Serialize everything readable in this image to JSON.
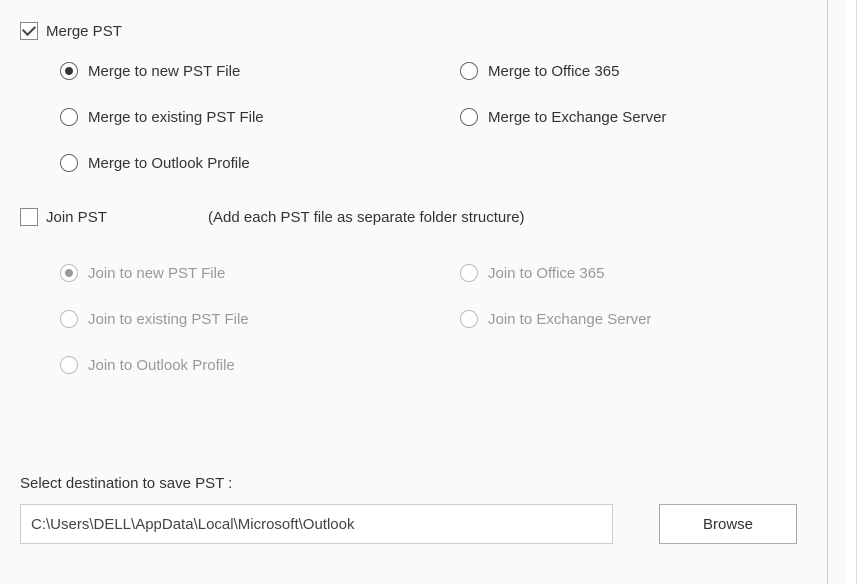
{
  "merge": {
    "checkbox_label": "Merge PST",
    "checked": true,
    "options": [
      {
        "label": "Merge to new PST File",
        "selected": true
      },
      {
        "label": "Merge to Office 365",
        "selected": false
      },
      {
        "label": "Merge to existing PST File",
        "selected": false
      },
      {
        "label": "Merge to Exchange Server",
        "selected": false
      },
      {
        "label": "Merge to Outlook Profile",
        "selected": false
      }
    ]
  },
  "join": {
    "checkbox_label": "Join PST",
    "checked": false,
    "hint": "(Add each PST file as separate folder structure)",
    "options": [
      {
        "label": "Join to new PST File",
        "selected": true
      },
      {
        "label": "Join to Office 365",
        "selected": false
      },
      {
        "label": "Join to existing PST File",
        "selected": false
      },
      {
        "label": "Join to Exchange Server",
        "selected": false
      },
      {
        "label": "Join to Outlook Profile",
        "selected": false
      }
    ]
  },
  "destination": {
    "label": "Select destination to save PST :",
    "path": "C:\\Users\\DELL\\AppData\\Local\\Microsoft\\Outlook",
    "browse_label": "Browse"
  }
}
